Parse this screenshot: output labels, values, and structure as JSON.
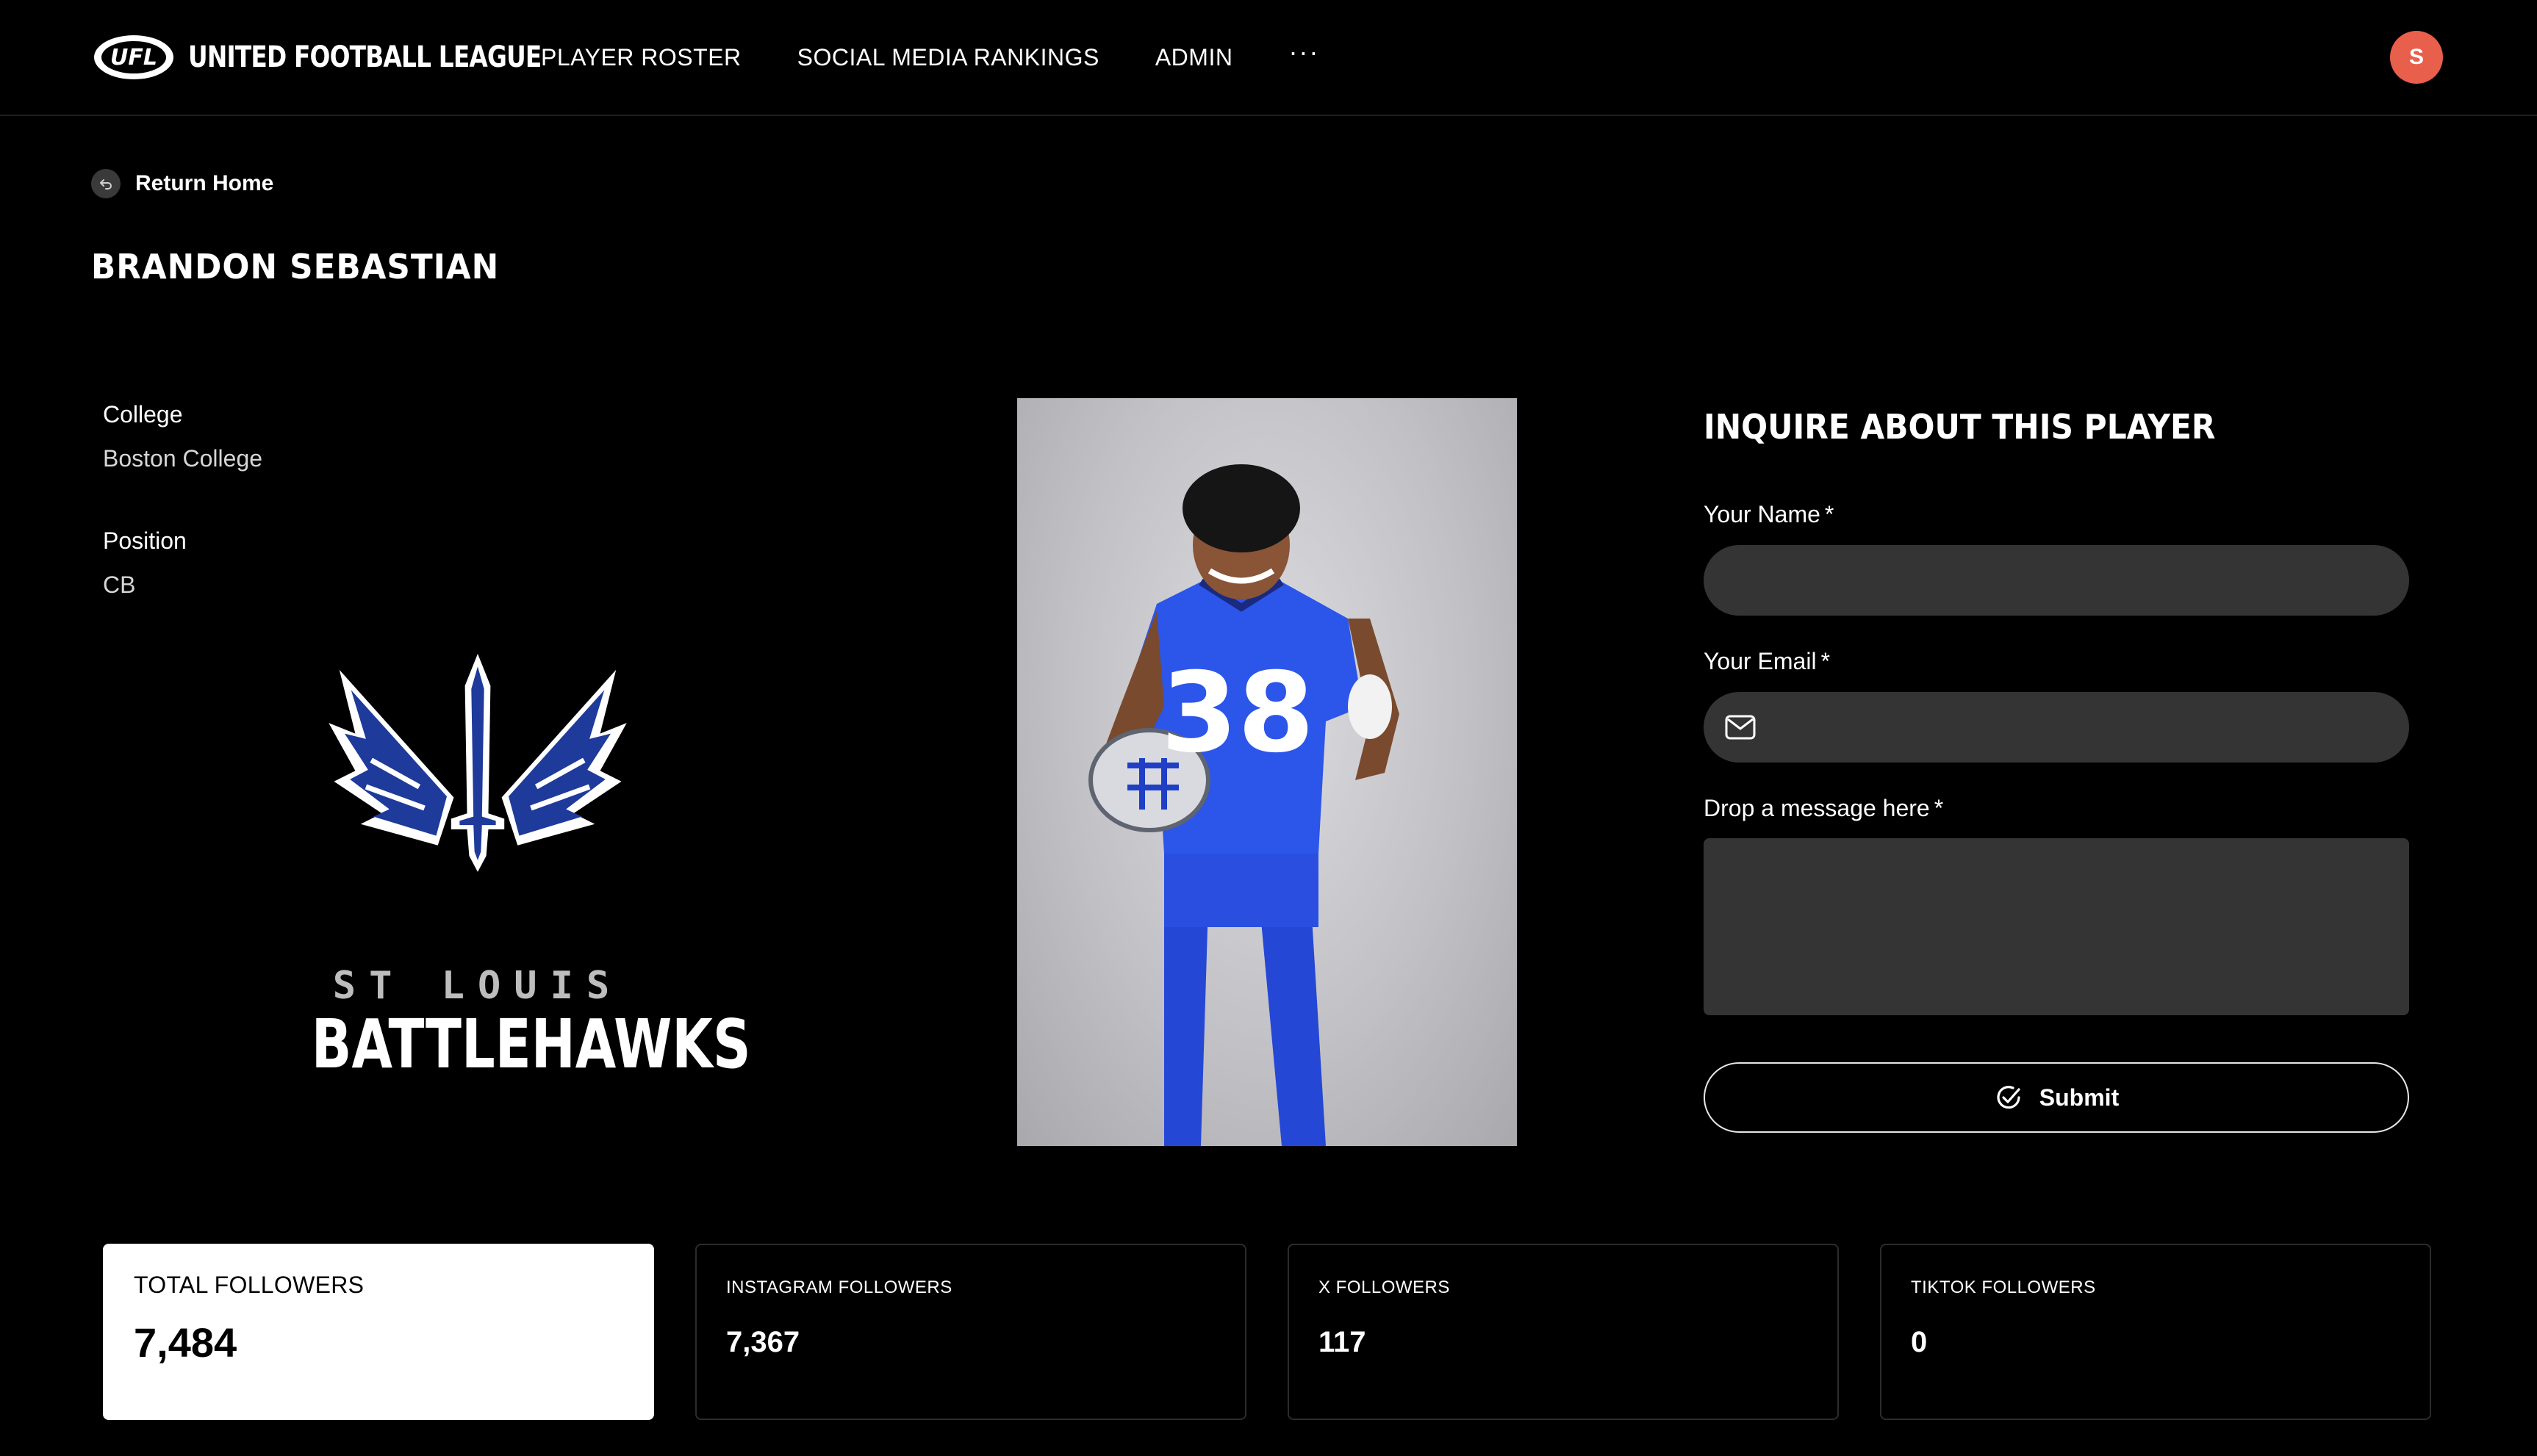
{
  "brand": {
    "name": "UNITED FOOTBALL LEAGUE",
    "mark": "UFL"
  },
  "nav": {
    "links": [
      "PLAYER ROSTER",
      "SOCIAL MEDIA RANKINGS",
      "ADMIN"
    ],
    "more": "···"
  },
  "user": {
    "initial": "S",
    "avatar_color": "#e8604c"
  },
  "back": {
    "label": "Return Home"
  },
  "player": {
    "name": "BRANDON SEBASTIAN",
    "fields": [
      {
        "label": "College",
        "value": "Boston College"
      },
      {
        "label": "Position",
        "value": "CB"
      }
    ],
    "jersey_number": "38"
  },
  "team": {
    "line1": "ST LOUIS",
    "line2": "BATTLEHAWKS",
    "color": "#1e40af"
  },
  "form": {
    "title": "INQUIRE ABOUT THIS PLAYER",
    "name_label": "Your Name",
    "email_label": "Your Email",
    "message_label": "Drop a message here",
    "required_marker": "*",
    "name_value": "",
    "email_value": "",
    "message_value": "",
    "submit_label": "Submit"
  },
  "stats": [
    {
      "label": "TOTAL FOLLOWERS",
      "value": "7,484"
    },
    {
      "label": "INSTAGRAM FOLLOWERS",
      "value": "7,367"
    },
    {
      "label": "X FOLLOWERS",
      "value": "117"
    },
    {
      "label": "TIKTOK FOLLOWERS",
      "value": "0"
    }
  ]
}
